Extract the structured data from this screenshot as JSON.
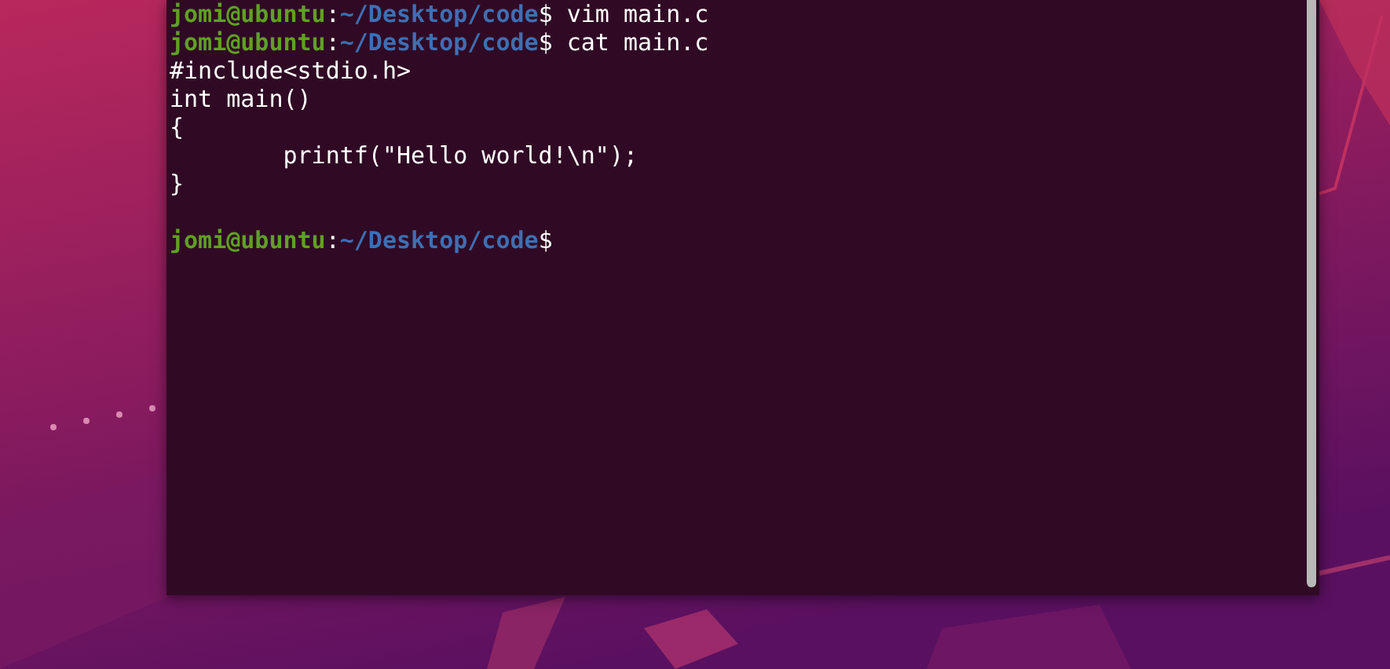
{
  "terminal": {
    "lines": [
      {
        "kind": "prompt",
        "user_host": "jomi@ubuntu",
        "separator": ":",
        "path": "~/Desktop/code",
        "symbol": "$",
        "command": "vim main.c"
      },
      {
        "kind": "prompt",
        "user_host": "jomi@ubuntu",
        "separator": ":",
        "path": "~/Desktop/code",
        "symbol": "$",
        "command": "cat main.c"
      },
      {
        "kind": "output",
        "text": "#include<stdio.h>"
      },
      {
        "kind": "output",
        "text": "int main()"
      },
      {
        "kind": "output",
        "text": "{"
      },
      {
        "kind": "output",
        "text": "        printf(\"Hello world!\\n\");"
      },
      {
        "kind": "output",
        "text": "}"
      },
      {
        "kind": "blank"
      },
      {
        "kind": "prompt",
        "user_host": "jomi@ubuntu",
        "separator": ":",
        "path": "~/Desktop/code",
        "symbol": "$"
      }
    ]
  }
}
